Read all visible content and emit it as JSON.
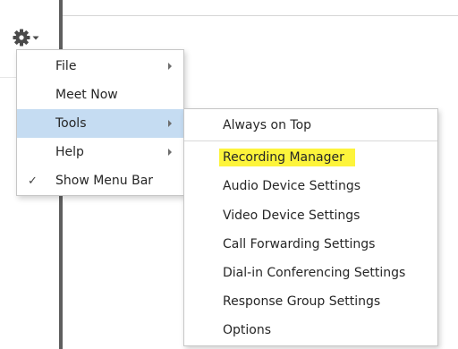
{
  "toolbar": {
    "gear_icon": "gear-icon",
    "dropdown_icon": "caret-down-icon"
  },
  "main_menu": {
    "items": [
      {
        "label": "File",
        "has_submenu": true,
        "checked": false
      },
      {
        "label": "Meet Now",
        "has_submenu": false,
        "checked": false
      },
      {
        "label": "Tools",
        "has_submenu": true,
        "checked": false,
        "highlighted": true
      },
      {
        "label": "Help",
        "has_submenu": true,
        "checked": false
      },
      {
        "label": "Show Menu Bar",
        "has_submenu": false,
        "checked": true
      }
    ],
    "check_glyph": "✓"
  },
  "tools_submenu": {
    "items": [
      {
        "label": "Always on Top"
      },
      {
        "label": "Recording Manager",
        "marker_highlight": true
      },
      {
        "label": "Audio Device Settings"
      },
      {
        "label": "Video Device Settings"
      },
      {
        "label": "Call Forwarding Settings"
      },
      {
        "label": "Dial-in Conferencing Settings"
      },
      {
        "label": "Response Group Settings"
      },
      {
        "label": "Options"
      }
    ]
  },
  "colors": {
    "menu_highlight": "#c5dcf2",
    "marker_highlight": "#fdf43b",
    "app_border": "#5f5f5f",
    "text": "#262626"
  }
}
